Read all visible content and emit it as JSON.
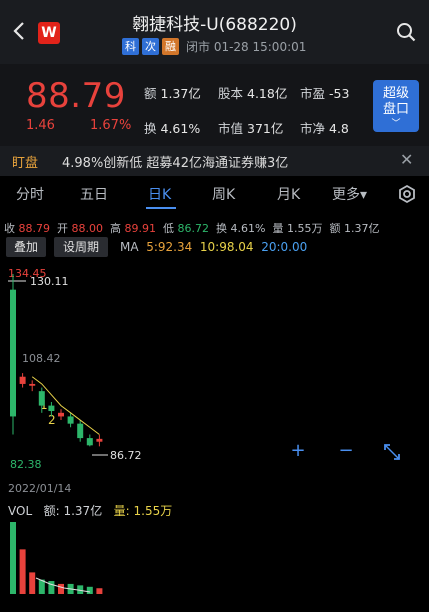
{
  "header": {
    "title": "翱捷科技-U(688220)",
    "tags": [
      "科",
      "次",
      "融"
    ],
    "status": "闭市 01-28 15:00:01",
    "logo_text": "W"
  },
  "quote": {
    "price": "88.79",
    "change": "1.46",
    "change_pct": "1.67%",
    "amount_label": "额",
    "amount": "1.37亿",
    "shares_label": "股本",
    "shares": "4.18亿",
    "pe_label": "市盈",
    "pe": "-53",
    "turnover_label": "换",
    "turnover": "4.61%",
    "mcap_label": "市值",
    "mcap": "371亿",
    "pb_label": "市净",
    "pb": "4.8",
    "super_btn_line1": "超级",
    "super_btn_line2": "盘口"
  },
  "ticker": {
    "label": "盯盘",
    "text": "4.98%创新低 超募42亿海通证券赚3亿"
  },
  "tabs": [
    "分时",
    "五日",
    "日K",
    "周K",
    "月K",
    "更多▾"
  ],
  "active_tab": "日K",
  "ohlc": {
    "close_label": "收",
    "close": "88.79",
    "open_label": "开",
    "open": "88.00",
    "high_label": "高",
    "high": "89.91",
    "low_label": "低",
    "low": "86.72",
    "turn_label": "换",
    "turn": "4.61%",
    "vol_label": "量",
    "vol": "1.55万",
    "amt_label": "额",
    "amt": "1.37亿"
  },
  "buttons": {
    "overlay": "叠加",
    "period": "设周期"
  },
  "ma": {
    "label": "MA",
    "ma5": "5:92.34",
    "ma10": "10:98.04",
    "ma20": "20:0.00"
  },
  "chart_data": {
    "type": "candlestick",
    "labels": {
      "top_high": "134.45",
      "high_marker": "130.11",
      "mid_level": "108.42",
      "low_axis": "82.38",
      "low_marker": "86.72",
      "note1": "1",
      "note2": "2"
    },
    "date_label": "2022/01/14",
    "candles": [
      {
        "o": 95,
        "c": 130.11,
        "h": 134.45,
        "l": 90,
        "color": "green"
      },
      {
        "o": 106,
        "c": 104,
        "h": 107,
        "l": 103,
        "color": "red"
      },
      {
        "o": 104,
        "c": 103.5,
        "h": 105,
        "l": 102,
        "color": "red"
      },
      {
        "o": 102,
        "c": 98,
        "h": 103,
        "l": 96,
        "color": "green"
      },
      {
        "o": 98,
        "c": 96.5,
        "h": 99,
        "l": 95,
        "color": "green"
      },
      {
        "o": 96,
        "c": 95,
        "h": 97,
        "l": 94,
        "color": "red"
      },
      {
        "o": 95,
        "c": 93,
        "h": 96,
        "l": 92,
        "color": "green"
      },
      {
        "o": 93,
        "c": 89,
        "h": 94,
        "l": 88,
        "color": "green"
      },
      {
        "o": 89,
        "c": 87,
        "h": 90,
        "l": 86.72,
        "color": "green"
      },
      {
        "o": 88,
        "c": 88.79,
        "h": 89.91,
        "l": 86.72,
        "color": "red"
      }
    ],
    "ma_line": [
      106,
      104,
      101,
      98,
      96,
      94,
      92,
      90
    ]
  },
  "volume": {
    "label": "VOL",
    "amount_label": "额:",
    "amount": "1.37亿",
    "qty_label": "量:",
    "qty": "1.55万",
    "bars": [
      {
        "v": 100,
        "color": "green"
      },
      {
        "v": 62,
        "color": "red"
      },
      {
        "v": 30,
        "color": "red"
      },
      {
        "v": 20,
        "color": "green"
      },
      {
        "v": 18,
        "color": "green"
      },
      {
        "v": 14,
        "color": "red"
      },
      {
        "v": 14,
        "color": "green"
      },
      {
        "v": 12,
        "color": "green"
      },
      {
        "v": 10,
        "color": "green"
      },
      {
        "v": 8,
        "color": "red"
      }
    ]
  },
  "colors": {
    "red": "#e8423c",
    "green": "#2db66a",
    "accent": "#4a8ff0"
  }
}
